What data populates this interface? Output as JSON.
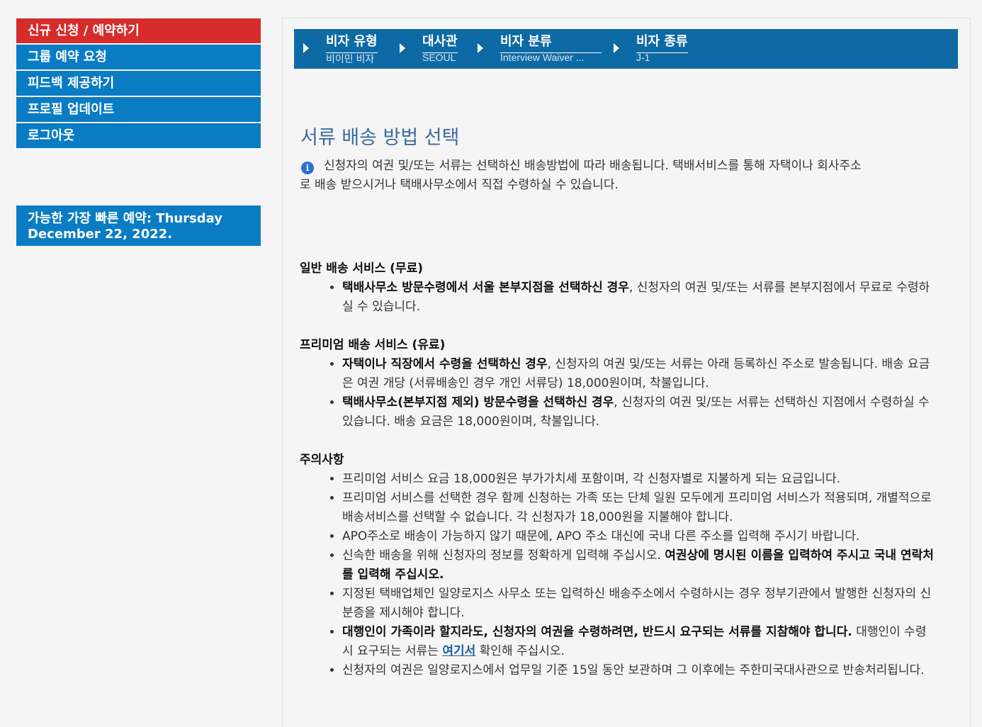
{
  "sidebar": {
    "items": [
      {
        "label": "신규 신청 / 예약하기",
        "active": true
      },
      {
        "label": "그룹 예약 요청"
      },
      {
        "label": "피드백 제공하기"
      },
      {
        "label": "프로필 업데이트"
      },
      {
        "label": "로그아웃"
      }
    ],
    "earliest_line1": "가능한 가장 빠른 예약: Thursday",
    "earliest_line2": "December 22, 2022."
  },
  "progress": {
    "steps": [
      {
        "label": "비자 유형",
        "value": "비이민 비자"
      },
      {
        "label": "대사관",
        "value": "SEOUL"
      },
      {
        "label": "비자 분류",
        "value": "Interview Waiver ..."
      },
      {
        "label": "비자 종류",
        "value": "J-1"
      }
    ]
  },
  "content": {
    "title": "서류 배송 방법 선택",
    "intro_line1": "신청자의 여권 및/또는 서류는 선택하신 배송방법에 따라 배송됩니다.  택배서비스를 통해 자택이나 회사주소",
    "intro_line2": "로 배송 받으시거나 택배사무소에서 직접 수령하실 수 있습니다.",
    "standard": {
      "heading": "일반 배송 서비스 (무료)",
      "item1_bold": "택배사무소 방문수령에서 서울 본부지점을 선택하신 경우",
      "item1_text": ", 신청자의 여권 및/또는 서류를 본부지점에서 무료로 수령하실 수 있습니다."
    },
    "premium": {
      "heading": "프리미엄 배송 서비스 (유료)",
      "item1_bold": "자택이나 직장에서 수령을 선택하신 경우",
      "item1_text": ", 신청자의 여권 및/또는 서류는 아래 등록하신 주소로 발송됩니다. 배송 요금은 여권 개당 (서류배송인 경우 개인 서류당) 18,000원이며, 착불입니다.",
      "item2_bold": "택배사무소(본부지점 제외) 방문수령을 선택하신 경우",
      "item2_text": ", 신청자의 여권 및/또는 서류는 선택하신 지점에서 수령하실 수 있습니다. 배송 요금은 18,000원이며, 착불입니다."
    },
    "notes": {
      "heading": "주의사항",
      "n1": "프리미엄 서비스 요금 18,000원은 부가가치세 포함이며, 각 신청자별로 지불하게 되는 요금입니다.",
      "n2": "프리미엄 서비스를 선택한 경우 함께 신청하는 가족 또는 단체 일원 모두에게 프리미엄 서비스가 적용되며, 개별적으로 배송서비스를 선택할 수 없습니다.  각 신청자가 18,000원을 지불해야 합니다.",
      "n3": "APO주소로 배송이 가능하지 않기 때문에, APO 주소 대신에 국내 다른 주소를 입력해 주시기 바랍니다.",
      "n4_text": "신속한 배송을 위해 신청자의 정보를 정확하게 입력해 주십시오. ",
      "n4_bold": "여권상에 명시된 이름을 입력하여 주시고 국내 연락처를 입력해 주십시오.",
      "n5": "지정된 택배업체인 일양로지스 사무소 또는 입력하신 배송주소에서 수령하시는 경우 정부기관에서 발행한 신청자의 신분증을 제시해야 합니다.",
      "n6_bold": "대행인이 가족이라 할지라도, 신청자의 여권을 수령하려면, 반드시 요구되는 서류를 지참해야 합니다.",
      "n6_text": " 대행인이 수령시 요구되는 서류는 ",
      "n6_link": "여기서",
      "n6_tail": " 확인해 주십시오.",
      "n7": "신청자의 여권은 일양로지스에서 업무일 기준 15일 동안 보관하며 그 이후에는 주한미국대사관으로 반송처리됩니다."
    }
  }
}
